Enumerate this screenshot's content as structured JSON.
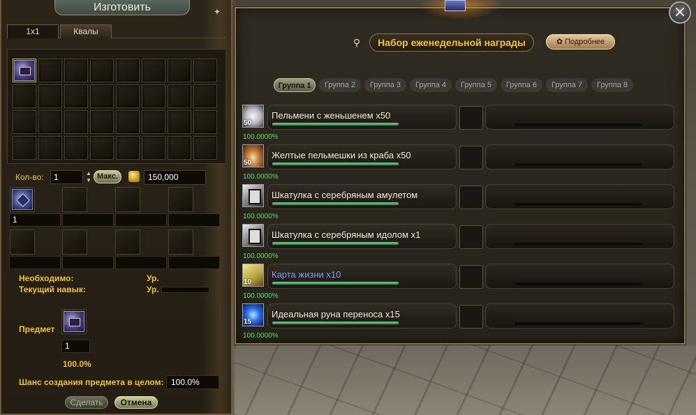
{
  "left_panel": {
    "title": "Изготовить",
    "tabs": [
      {
        "label": "1x1",
        "active": false
      },
      {
        "label": "Квалы",
        "active": true
      }
    ],
    "inventory": {
      "rows": 4,
      "cols": 8,
      "filled_slots": [
        0
      ]
    },
    "quantity": {
      "label": "Кол-во:",
      "value": "1",
      "max_label": "Макс.",
      "gold_value": "150,000"
    },
    "materials": {
      "first_qty": "1"
    },
    "required_label": "Необходимо:",
    "required_level_label": "Ур.",
    "current_skill_label": "Текущий навык:",
    "current_skill_level_label": "Ур.",
    "item_label": "Предмет",
    "item_qty": "1",
    "item_chance": "100.0%",
    "overall_chance_label": "Шанс создания предмета в целом:",
    "overall_chance_value": "100.0%",
    "do_button": "Сделать",
    "cancel_button": "Отмена"
  },
  "right_panel": {
    "title": "Набор еженедельной награды",
    "details_button": "Подробнее",
    "group_tabs": [
      "Группа 1",
      "Группа 2",
      "Группа 3",
      "Группа 4",
      "Группа 5",
      "Группа 6",
      "Группа 7",
      "Группа 8"
    ],
    "active_group": 0,
    "rewards": [
      {
        "name": "Пельмени с женьшенем x50",
        "badge": "50",
        "pct": "100.0000%",
        "icon": "dumpling-icon",
        "color": "#f0e8d8",
        "progress": 1.0
      },
      {
        "name": "Желтые пельмешки из краба x50",
        "badge": "50",
        "pct": "100.0000%",
        "icon": "crab-dumpling-icon",
        "color": "#f0e8d8",
        "progress": 1.0
      },
      {
        "name": "Шкатулка с серебряным амулетом",
        "badge": "",
        "pct": "100.0000%",
        "icon": "amulet-box-icon",
        "color": "#f0e8d8",
        "progress": 1.0
      },
      {
        "name": "Шкатулка с серебряным идолом x1",
        "badge": "",
        "pct": "100.0000%",
        "icon": "idol-box-icon",
        "color": "#f0e8d8",
        "progress": 1.0
      },
      {
        "name": "Карта жизни x10",
        "badge": "10",
        "pct": "100.0000%",
        "icon": "life-map-icon",
        "color": "#8a9cf0",
        "progress": 1.0
      },
      {
        "name": "Идеальная руна переноса x15",
        "badge": "15",
        "pct": "100.0000%",
        "icon": "transfer-rune-icon",
        "color": "#f0e8d8",
        "progress": 1.0
      }
    ]
  },
  "colors": {
    "accent_gold": "#f0c040",
    "percent_green": "#58e058",
    "bar_green": "#3aa060"
  }
}
